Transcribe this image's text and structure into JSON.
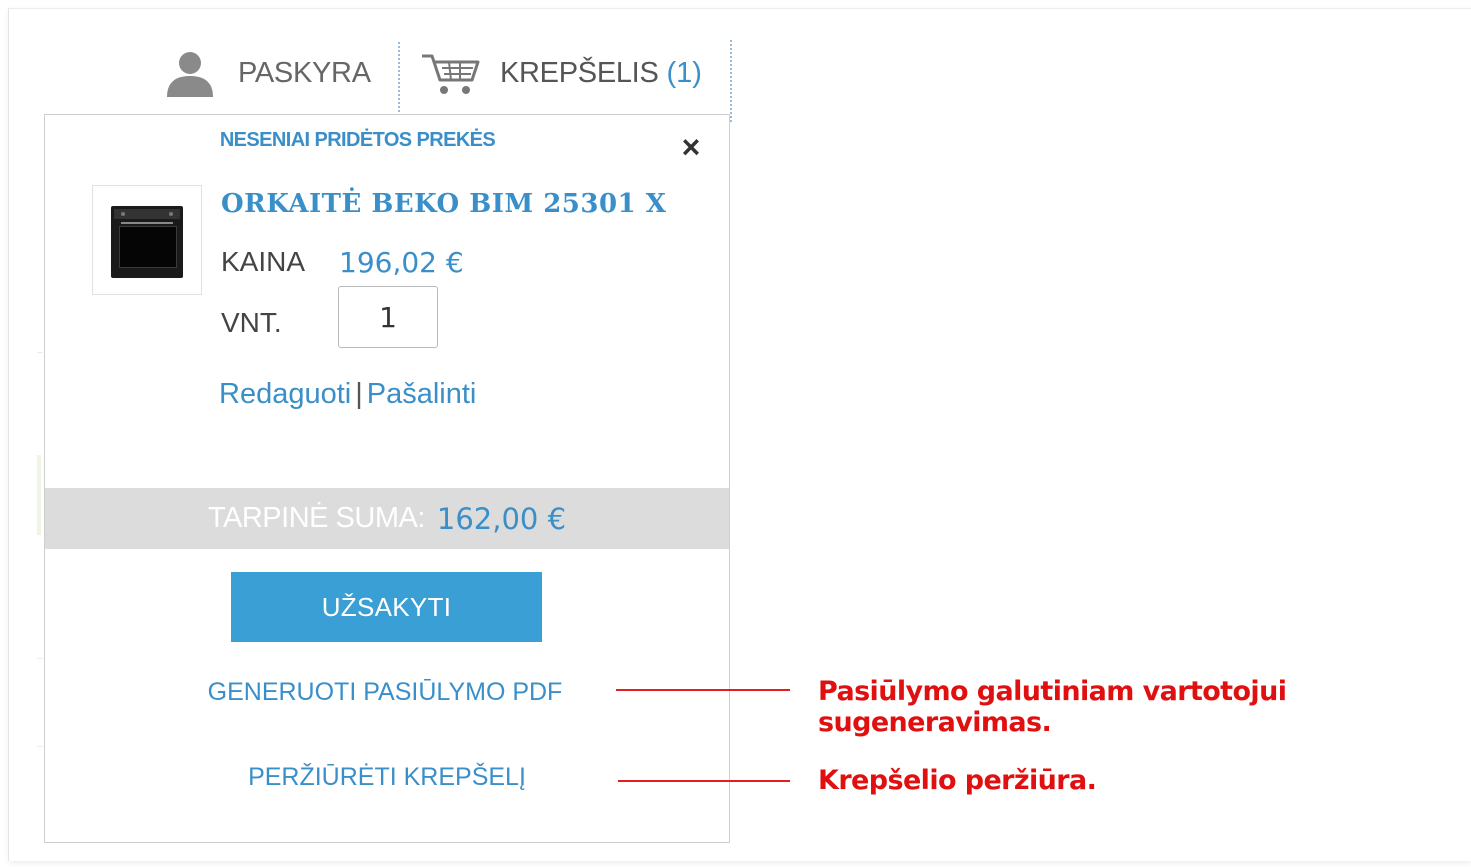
{
  "header": {
    "account_label": "PASKYRA",
    "cart_label": "KREPŠELIS",
    "cart_count": "(1)"
  },
  "dropdown": {
    "title": "NESENIAI PRIDĖTOS PREKĖS",
    "close_symbol": "×",
    "item": {
      "name": "ORKAITĖ BEKO BIM 25301 X",
      "price_label": "KAINA",
      "price": "196,02 €",
      "qty_label": "VNT.",
      "qty": "1",
      "edit_link": "Redaguoti",
      "separator": "|",
      "remove_link": "Pašalinti"
    },
    "subtotal_label": "TARPINĖ SUMA:",
    "subtotal_value": "162,00 €",
    "order_button": "UŽSAKYTI",
    "pdf_link": "GENERUOTI PASIŪLYMO PDF",
    "view_cart_link": "PERŽIŪRĖTI KREPŠELĮ"
  },
  "annotations": {
    "pdf_note": "Pasiūlymo galutiniam vartotojui sugeneravimas.",
    "view_note": "Krepšelio peržiūra."
  },
  "colors": {
    "accent": "#3a8fc9",
    "button": "#3a9fd4",
    "annotation": "#e01010",
    "subtotal_bg": "#dcdcdc"
  },
  "icons": {
    "account": "user-icon",
    "cart": "cart-icon",
    "close": "close-icon"
  }
}
